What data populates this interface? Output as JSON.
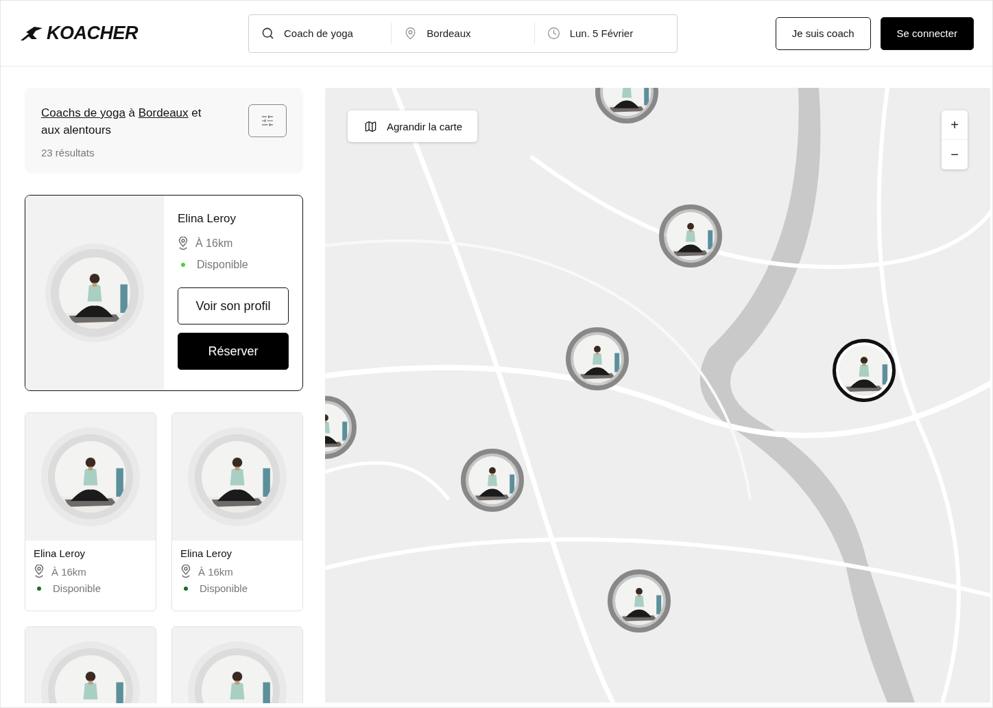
{
  "header": {
    "logo": "KOACHER",
    "search": [
      {
        "kind": "query",
        "value": "Coach de yoga"
      },
      {
        "kind": "place",
        "value": "Bordeaux"
      },
      {
        "kind": "date",
        "value": "Lun. 5 Février"
      }
    ],
    "buttons": [
      {
        "label": "Je suis coach",
        "kind": "outline"
      },
      {
        "label": "Se connecter",
        "kind": "solid"
      }
    ]
  },
  "results": {
    "title": [
      {
        "text": "Coachs de yoga",
        "link": true
      },
      {
        "text": " à ",
        "link": false
      },
      {
        "text": "Bordeaux",
        "link": true
      },
      {
        "text": " et aux alentours",
        "link": false
      }
    ],
    "count": "23 résultats"
  },
  "featured": {
    "selected": true,
    "name": "Elina Leroy",
    "distance": "À 16km",
    "status": {
      "text": "Disponible",
      "color": "#4cd137"
    },
    "buttons": [
      "Voir son profil",
      "Réserver"
    ]
  },
  "cards": [
    {
      "kind": "full",
      "name": "Elina Leroy",
      "distance": "À 16km",
      "status": {
        "text": "Disponible",
        "color": "#1e6b2a"
      }
    },
    {
      "kind": "full",
      "name": "Elina Leroy",
      "distance": "À 16km",
      "status": {
        "text": "Disponible",
        "color": "#1e6b2a"
      }
    },
    {
      "kind": "cropped"
    },
    {
      "kind": "cropped"
    }
  ],
  "map": {
    "expand_button": "Agrandir la carte",
    "zoom": [
      "+",
      "−"
    ],
    "markers": [
      {
        "selected": false
      },
      {
        "selected": false
      },
      {
        "selected": false
      },
      {
        "selected": false
      },
      {
        "selected": false
      },
      {
        "selected": false
      },
      {
        "selected": true
      }
    ]
  }
}
